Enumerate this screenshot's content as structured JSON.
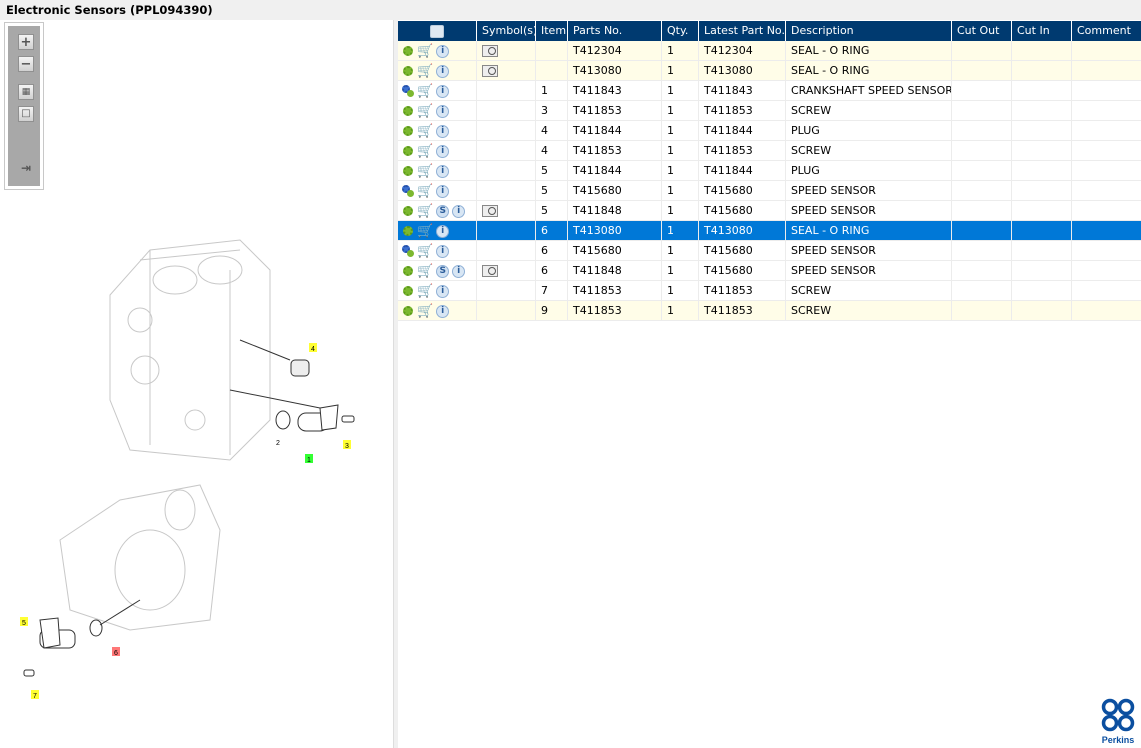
{
  "window": {
    "title": "Electronic Sensors (PPL094390)"
  },
  "toolbar": {
    "zoom_in": "+",
    "zoom_out": "−",
    "fit_all": "fit-icon",
    "actual": "actual-size-icon",
    "export": "export-icon"
  },
  "diagram": {
    "callouts": [
      "4",
      "2",
      "1",
      "3",
      "5",
      "6",
      "7"
    ]
  },
  "table": {
    "headers": [
      "Symbol(s)",
      "Item",
      "Parts No.",
      "Qty.",
      "Latest Part No.",
      "Description",
      "Cut Out",
      "Cut In",
      "Comment"
    ],
    "rows": [
      {
        "gear": "green",
        "s": false,
        "book": true,
        "item": "",
        "part": "T412304",
        "qty": "1",
        "latest": "T412304",
        "desc": "SEAL - O RING",
        "style": "yellow"
      },
      {
        "gear": "green",
        "s": false,
        "book": true,
        "item": "",
        "part": "T413080",
        "qty": "1",
        "latest": "T413080",
        "desc": "SEAL - O RING",
        "style": "yellow"
      },
      {
        "gear": "blue",
        "s": false,
        "book": false,
        "item": "1",
        "part": "T411843",
        "qty": "1",
        "latest": "T411843",
        "desc": "CRANKSHAFT SPEED SENSOR",
        "style": ""
      },
      {
        "gear": "green",
        "s": false,
        "book": false,
        "item": "3",
        "part": "T411853",
        "qty": "1",
        "latest": "T411853",
        "desc": "SCREW",
        "style": ""
      },
      {
        "gear": "green",
        "s": false,
        "book": false,
        "item": "4",
        "part": "T411844",
        "qty": "1",
        "latest": "T411844",
        "desc": "PLUG",
        "style": ""
      },
      {
        "gear": "green",
        "s": false,
        "book": false,
        "item": "4",
        "part": "T411853",
        "qty": "1",
        "latest": "T411853",
        "desc": "SCREW",
        "style": ""
      },
      {
        "gear": "green",
        "s": false,
        "book": false,
        "item": "5",
        "part": "T411844",
        "qty": "1",
        "latest": "T411844",
        "desc": "PLUG",
        "style": ""
      },
      {
        "gear": "blue",
        "s": false,
        "book": false,
        "item": "5",
        "part": "T415680",
        "qty": "1",
        "latest": "T415680",
        "desc": "SPEED SENSOR",
        "style": ""
      },
      {
        "gear": "green",
        "s": true,
        "book": true,
        "item": "5",
        "part": "T411848",
        "qty": "1",
        "latest": "T415680",
        "desc": "SPEED SENSOR",
        "style": ""
      },
      {
        "gear": "green",
        "s": false,
        "book": false,
        "item": "6",
        "part": "T413080",
        "qty": "1",
        "latest": "T413080",
        "desc": "SEAL - O RING",
        "style": "sel"
      },
      {
        "gear": "blue",
        "s": false,
        "book": false,
        "item": "6",
        "part": "T415680",
        "qty": "1",
        "latest": "T415680",
        "desc": "SPEED SENSOR",
        "style": ""
      },
      {
        "gear": "green",
        "s": true,
        "book": true,
        "item": "6",
        "part": "T411848",
        "qty": "1",
        "latest": "T415680",
        "desc": "SPEED SENSOR",
        "style": ""
      },
      {
        "gear": "green",
        "s": false,
        "book": false,
        "item": "7",
        "part": "T411853",
        "qty": "1",
        "latest": "T411853",
        "desc": "SCREW",
        "style": ""
      },
      {
        "gear": "green",
        "s": false,
        "book": false,
        "item": "9",
        "part": "T411853",
        "qty": "1",
        "latest": "T411853",
        "desc": "SCREW",
        "style": "yellow"
      }
    ],
    "s_label": "S",
    "i_label": "i"
  },
  "brand": {
    "name": "Perkins",
    "color": "#0b4fa0"
  },
  "colors": {
    "header": "#003a70",
    "selected": "#0078d7",
    "highlight": "#fffde8"
  }
}
